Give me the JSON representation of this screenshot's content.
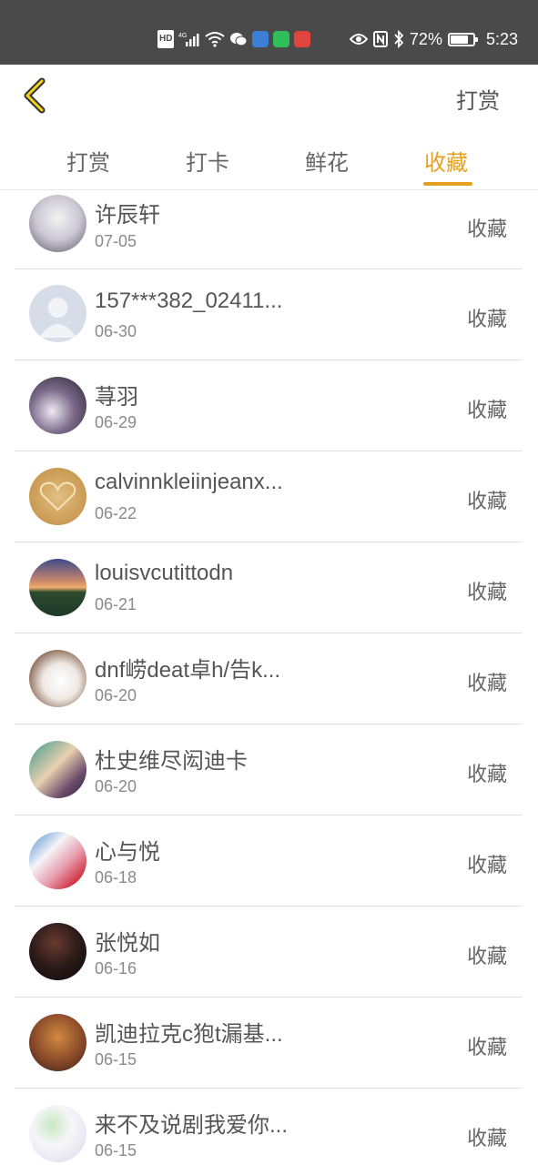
{
  "status_bar": {
    "hd": "HD",
    "network": "4G",
    "battery_pct": "72%",
    "battery_level": 0.72,
    "time": "5:23",
    "icons": [
      "hd-icon",
      "signal-icon",
      "wifi-icon",
      "wechat-icon",
      "app-icon",
      "line-icon",
      "mail-icon",
      "eye-icon",
      "nfc-icon",
      "bluetooth-icon",
      "battery-icon"
    ]
  },
  "nav": {
    "back_icon": "chevron-left-icon",
    "right_label": "打赏"
  },
  "tabs": [
    {
      "label": "打赏",
      "active": false
    },
    {
      "label": "打卡",
      "active": false
    },
    {
      "label": "鲜花",
      "active": false
    },
    {
      "label": "收藏",
      "active": true
    }
  ],
  "colors": {
    "accent": "#e6a021",
    "status_bar_bg": "#4a4a4a"
  },
  "list": [
    {
      "name": "许辰轩",
      "date": "07-05",
      "action": "收藏"
    },
    {
      "name": "157***382_02411...",
      "date": "06-30",
      "action": "收藏"
    },
    {
      "name": "荨羽",
      "date": "06-29",
      "action": "收藏"
    },
    {
      "name": "calvinnkleiinjeanx...",
      "date": "06-22",
      "action": "收藏"
    },
    {
      "name": "louisvcutittodn",
      "date": "06-21",
      "action": "收藏"
    },
    {
      "name": "dnf崂deat卓h/告k...",
      "date": "06-20",
      "action": "收藏"
    },
    {
      "name": "杜史维尽闳迪卡",
      "date": "06-20",
      "action": "收藏"
    },
    {
      "name": "心与悦",
      "date": "06-18",
      "action": "收藏"
    },
    {
      "name": "张悦如",
      "date": "06-16",
      "action": "收藏"
    },
    {
      "name": "凯迪拉克c狍t漏基...",
      "date": "06-15",
      "action": "收藏"
    },
    {
      "name": "来不及说剧我爱你...",
      "date": "06-15",
      "action": "收藏"
    }
  ]
}
